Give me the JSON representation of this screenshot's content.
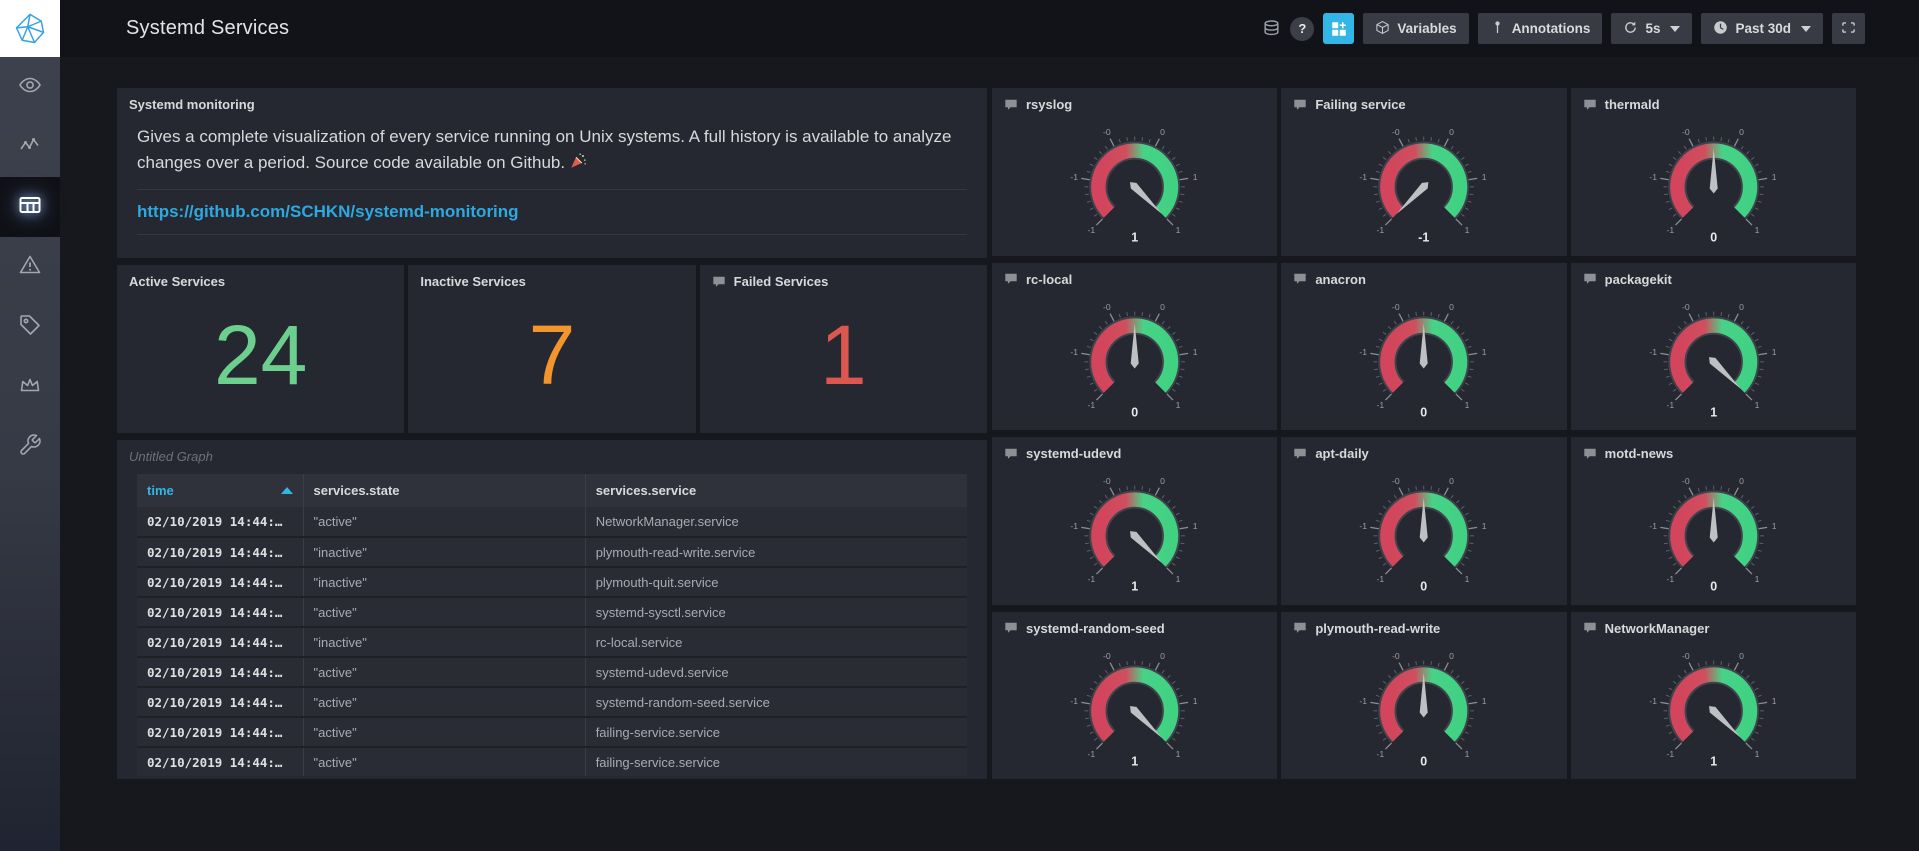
{
  "topnav": {
    "title": "Systemd Services",
    "help_glyph": "?",
    "variables_label": "Variables",
    "annotations_label": "Annotations",
    "refresh_interval": "5s",
    "time_range": "Past 30d"
  },
  "sidebar": {
    "items": [
      {
        "icon": "eye-icon",
        "active": false
      },
      {
        "icon": "metrics-icon",
        "active": false
      },
      {
        "icon": "dashboards-icon",
        "active": true
      },
      {
        "icon": "alerting-icon",
        "active": false
      },
      {
        "icon": "tag-icon",
        "active": false
      },
      {
        "icon": "crown-icon",
        "active": false
      },
      {
        "icon": "wrench-icon",
        "active": false
      }
    ]
  },
  "text_panel": {
    "title": "Systemd monitoring",
    "body": "Gives a complete visualization of every service running on Unix systems. A full history is available to analyze changes over a period. Source code available on Github.",
    "emoji": "🎉",
    "link": "https://github.com/SCHKN/systemd-monitoring"
  },
  "stats": [
    {
      "title": "Active Services",
      "value": "24",
      "color": "#6ccf8e",
      "has_description_icon": false
    },
    {
      "title": "Inactive Services",
      "value": "7",
      "color": "#f2952d",
      "has_description_icon": false
    },
    {
      "title": "Failed Services",
      "value": "1",
      "color": "#dd5751",
      "has_description_icon": true
    }
  ],
  "table_panel": {
    "title": "Untitled Graph",
    "columns": [
      "time",
      "services.state",
      "services.service"
    ],
    "sort": {
      "column": "time",
      "direction": "asc"
    },
    "rows": [
      {
        "time": "02/10/2019 14:44:…",
        "state": "\"active\"",
        "service": "NetworkManager.service"
      },
      {
        "time": "02/10/2019 14:44:…",
        "state": "\"inactive\"",
        "service": "plymouth-read-write.service"
      },
      {
        "time": "02/10/2019 14:44:…",
        "state": "\"inactive\"",
        "service": "plymouth-quit.service"
      },
      {
        "time": "02/10/2019 14:44:…",
        "state": "\"active\"",
        "service": "systemd-sysctl.service"
      },
      {
        "time": "02/10/2019 14:44:…",
        "state": "\"inactive\"",
        "service": "rc-local.service"
      },
      {
        "time": "02/10/2019 14:44:…",
        "state": "\"active\"",
        "service": "systemd-udevd.service"
      },
      {
        "time": "02/10/2019 14:44:…",
        "state": "\"active\"",
        "service": "systemd-random-seed.service"
      },
      {
        "time": "02/10/2019 14:44:…",
        "state": "\"active\"",
        "service": "failing-service.service"
      },
      {
        "time": "02/10/2019 14:44:…",
        "state": "\"active\"",
        "service": "failing-service.service"
      }
    ]
  },
  "chart_data": {
    "type": "gauge-grid",
    "min": -1,
    "max": 1,
    "tick_labels": [
      "-1",
      "-1",
      "-0",
      "0",
      "1",
      "1"
    ],
    "arc_color_low": "#d2455c",
    "arc_color_high": "#41d183",
    "needle_color": "#c6c8cc",
    "panels": [
      {
        "title": "rsyslog",
        "value": 1
      },
      {
        "title": "Failing service",
        "value": -1
      },
      {
        "title": "thermald",
        "value": 0
      },
      {
        "title": "rc-local",
        "value": 0
      },
      {
        "title": "anacron",
        "value": 0
      },
      {
        "title": "packagekit",
        "value": 1
      },
      {
        "title": "systemd-udevd",
        "value": 1
      },
      {
        "title": "apt-daily",
        "value": 0
      },
      {
        "title": "motd-news",
        "value": 0
      },
      {
        "title": "systemd-random-seed",
        "value": 1
      },
      {
        "title": "plymouth-read-write",
        "value": 0
      },
      {
        "title": "NetworkManager",
        "value": 1
      }
    ]
  },
  "colors": {
    "accent_blue": "#33b5e5",
    "panel_bg": "#262831",
    "page_bg": "#17181d",
    "link_blue": "#2da9e0"
  }
}
